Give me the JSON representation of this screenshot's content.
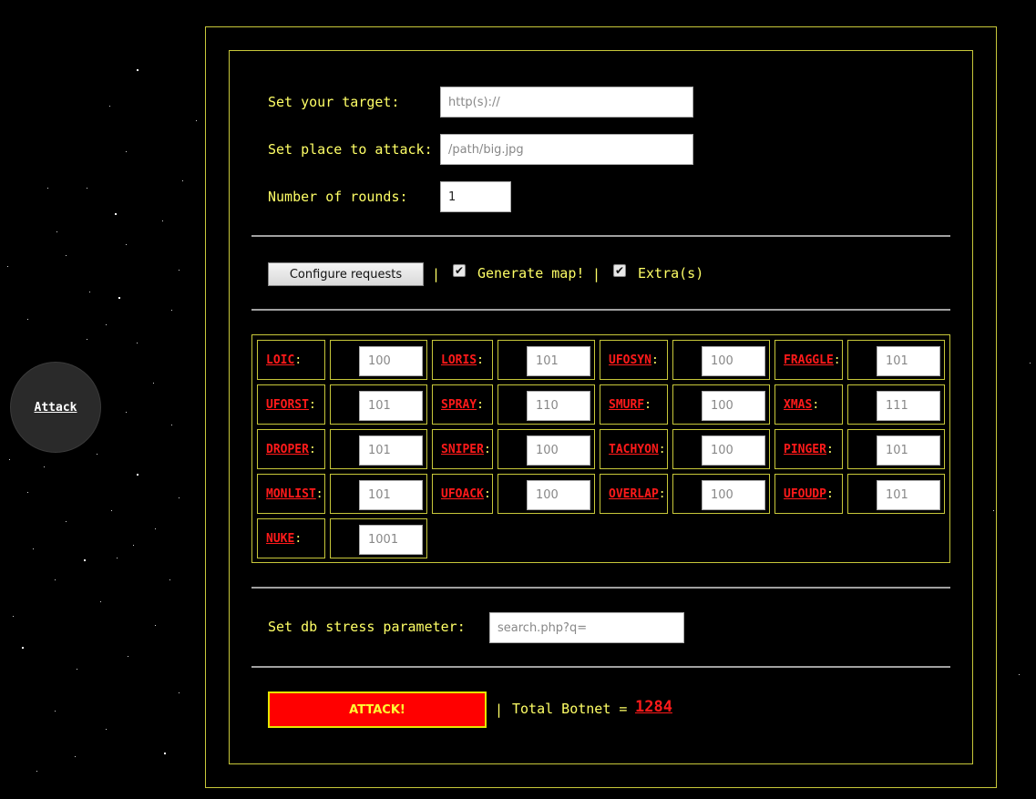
{
  "sidebar": {
    "attack_label": "Attack"
  },
  "form": {
    "target_label": "Set your target:",
    "target_placeholder": "http(s)://",
    "place_label": "Set place to attack:",
    "place_placeholder": "/path/big.jpg",
    "rounds_label": "Number of rounds:",
    "rounds_value": "1"
  },
  "options": {
    "configure_label": "Configure requests",
    "separator": "|",
    "generate_map_label": "Generate map!",
    "generate_map_checked": true,
    "extras_label": "Extra(s)",
    "extras_checked": true
  },
  "attacks": [
    {
      "name": "LOIC",
      "value": "100"
    },
    {
      "name": "LORIS",
      "value": "101"
    },
    {
      "name": "UFOSYN",
      "value": "100"
    },
    {
      "name": "FRAGGLE",
      "value": "101"
    },
    {
      "name": "UFORST",
      "value": "101"
    },
    {
      "name": "SPRAY",
      "value": "110"
    },
    {
      "name": "SMURF",
      "value": "100"
    },
    {
      "name": "XMAS",
      "value": "111"
    },
    {
      "name": "DROPER",
      "value": "101"
    },
    {
      "name": "SNIPER",
      "value": "100"
    },
    {
      "name": "TACHYON",
      "value": "100"
    },
    {
      "name": "PINGER",
      "value": "101"
    },
    {
      "name": "MONLIST",
      "value": "101"
    },
    {
      "name": "UFOACK",
      "value": "100"
    },
    {
      "name": "OVERLAP",
      "value": "100"
    },
    {
      "name": "UFOUDP",
      "value": "101"
    },
    {
      "name": "NUKE",
      "value": "1001"
    }
  ],
  "db_stress": {
    "label": "Set db stress parameter:",
    "placeholder": "search.php?q="
  },
  "footer": {
    "attack_button": "ATTACK!",
    "separator": "|",
    "total_label": "Total Botnet =",
    "total_value": "1284"
  },
  "colors": {
    "background": "#000000",
    "label_yellow": "#ffff66",
    "border_yellow": "#c8c83a",
    "attack_red": "#ff1a1a"
  }
}
